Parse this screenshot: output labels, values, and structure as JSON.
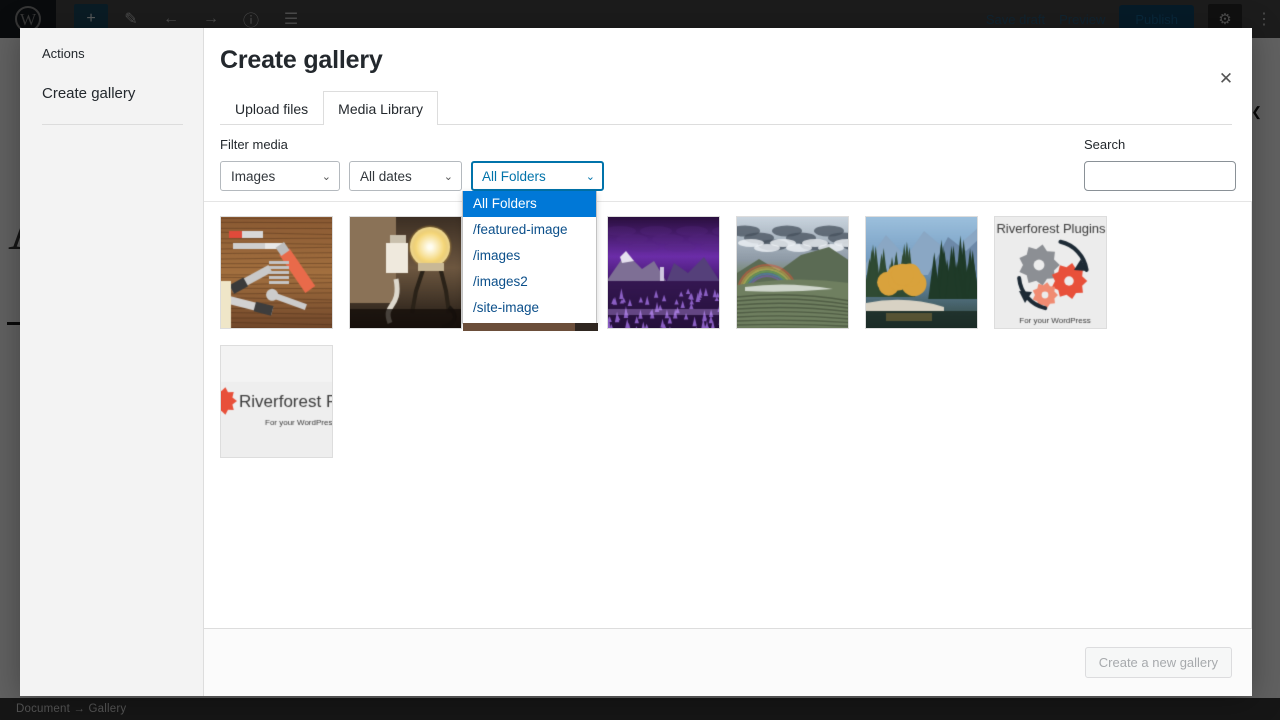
{
  "editor": {
    "toolbar": {
      "logo_icon": "wordpress-logo-icon",
      "add_block_label": "+",
      "edit_icon": "pencil-icon",
      "undo_icon": "undo-arrow-icon",
      "redo_icon": "redo-arrow-icon",
      "info_icon": "info-circle-icon",
      "list_view_icon": "list-view-icon",
      "save_draft_label": "Save draft",
      "preview_label": "Preview",
      "publish_label": "Publish",
      "settings_icon": "gear-icon",
      "more_icon": "more-vertical-icon"
    },
    "canvas_glyph": "A",
    "status_bar": {
      "breadcrumb": "Document  →  Gallery"
    }
  },
  "modal": {
    "title": "Create gallery",
    "close_label": "✕",
    "sidebar": {
      "heading": "Actions",
      "items": [
        {
          "label": "Create gallery"
        }
      ]
    },
    "tabs": [
      {
        "label": "Upload files",
        "active": false
      },
      {
        "label": "Media Library",
        "active": true
      }
    ],
    "filters": {
      "label": "Filter media",
      "type_select": {
        "value": "Images",
        "options": [
          "Images"
        ]
      },
      "date_select": {
        "value": "All dates",
        "options": [
          "All dates"
        ]
      },
      "folder_select": {
        "value": "All Folders",
        "focused": true,
        "open": true,
        "options": [
          {
            "label": "All Folders",
            "highlighted": true
          },
          {
            "label": "/featured-image",
            "highlighted": false
          },
          {
            "label": "/images",
            "highlighted": false
          },
          {
            "label": "/images2",
            "highlighted": false
          },
          {
            "label": "/site-image",
            "highlighted": false
          }
        ]
      }
    },
    "search": {
      "label": "Search",
      "value": "",
      "placeholder": ""
    },
    "media_items": [
      {
        "alt": "Assorted hand tools on wooden workbench",
        "kind": "tools"
      },
      {
        "alt": "Light bulb figure plugging cord into wall outlet",
        "kind": "bulb"
      },
      {
        "alt": "Purple night mountain valley landscape",
        "kind": "purple-valley"
      },
      {
        "alt": "Purple night mountain valley landscape",
        "kind": "purple-valley"
      },
      {
        "alt": "Rainbow over green mountain valley",
        "kind": "rainbow"
      },
      {
        "alt": "Autumn forest beside river with cliffs",
        "kind": "autumn"
      },
      {
        "alt": "Riverforest Plugins logo with gears",
        "kind": "logo-full",
        "text_top": "Riverforest Plugins",
        "text_bottom": "For your WordPress"
      },
      {
        "alt": "Riverforest Plugins wide banner",
        "kind": "logo-wide",
        "text_top": "Riverforest P",
        "text_bottom": "For your WordPres"
      }
    ],
    "footer": {
      "create_button_label": "Create a new gallery",
      "create_button_disabled": true
    }
  },
  "colors": {
    "accent_blue": "#0073aa",
    "highlight_blue": "#0078d7",
    "publish_blue": "#12486a",
    "modal_bg": "#ffffff",
    "rail_bg": "#f3f3f3"
  }
}
